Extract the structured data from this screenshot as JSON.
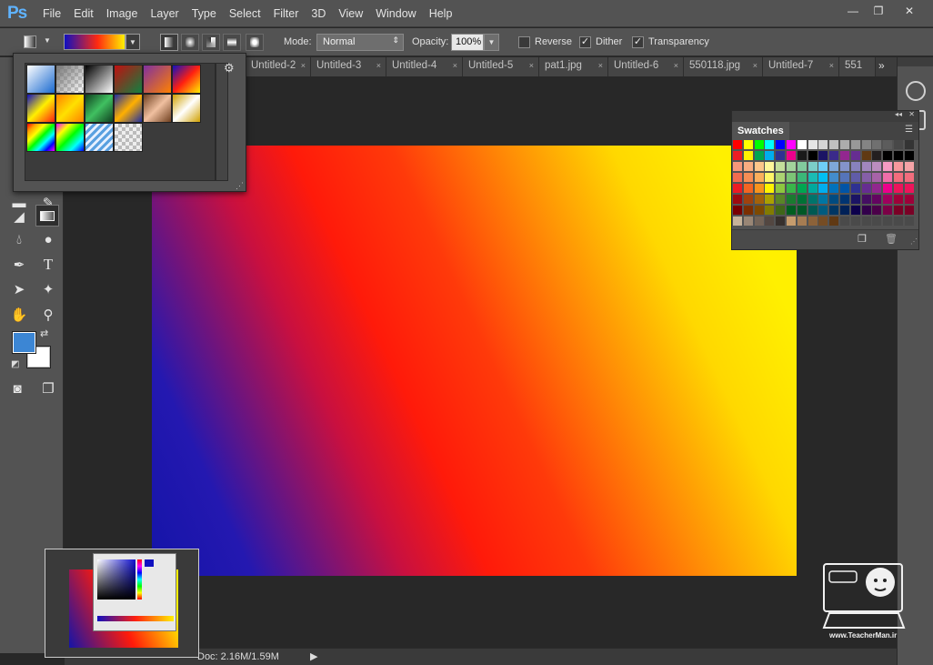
{
  "app": {
    "logo": "Ps"
  },
  "menu": [
    "File",
    "Edit",
    "Image",
    "Layer",
    "Type",
    "Select",
    "Filter",
    "3D",
    "View",
    "Window",
    "Help"
  ],
  "window_controls": {
    "minimize": "—",
    "restore": "❐",
    "close": "✕"
  },
  "options": {
    "mode_label": "Mode:",
    "mode_value": "Normal",
    "opacity_label": "Opacity:",
    "opacity_value": "100%",
    "reverse_label": "Reverse",
    "reverse_checked": false,
    "dither_label": "Dither",
    "dither_checked": true,
    "transparency_label": "Transparency",
    "transparency_checked": true
  },
  "tabs": [
    {
      "label": "Untitled-2"
    },
    {
      "label": "Untitled-3"
    },
    {
      "label": "Untitled-4"
    },
    {
      "label": "Untitled-5"
    },
    {
      "label": "pat1.jpg"
    },
    {
      "label": "Untitled-6"
    },
    {
      "label": "550118.jpg"
    },
    {
      "label": "Untitled-7"
    },
    {
      "label": "551"
    }
  ],
  "tab_close_glyph": "×",
  "tab_overflow": "»",
  "foreground_color": "#3c86d4",
  "background_color": "#ffffff",
  "canvas_gradient": [
    "#1414a8",
    "#ff1a0a",
    "#fff000"
  ],
  "swatches_panel": {
    "title": "Swatches"
  },
  "status": {
    "doc": "Doc: 2.16M/1.59M",
    "arrow": "▶"
  },
  "watermark": {
    "text": "www.TeacherMan.ir"
  }
}
